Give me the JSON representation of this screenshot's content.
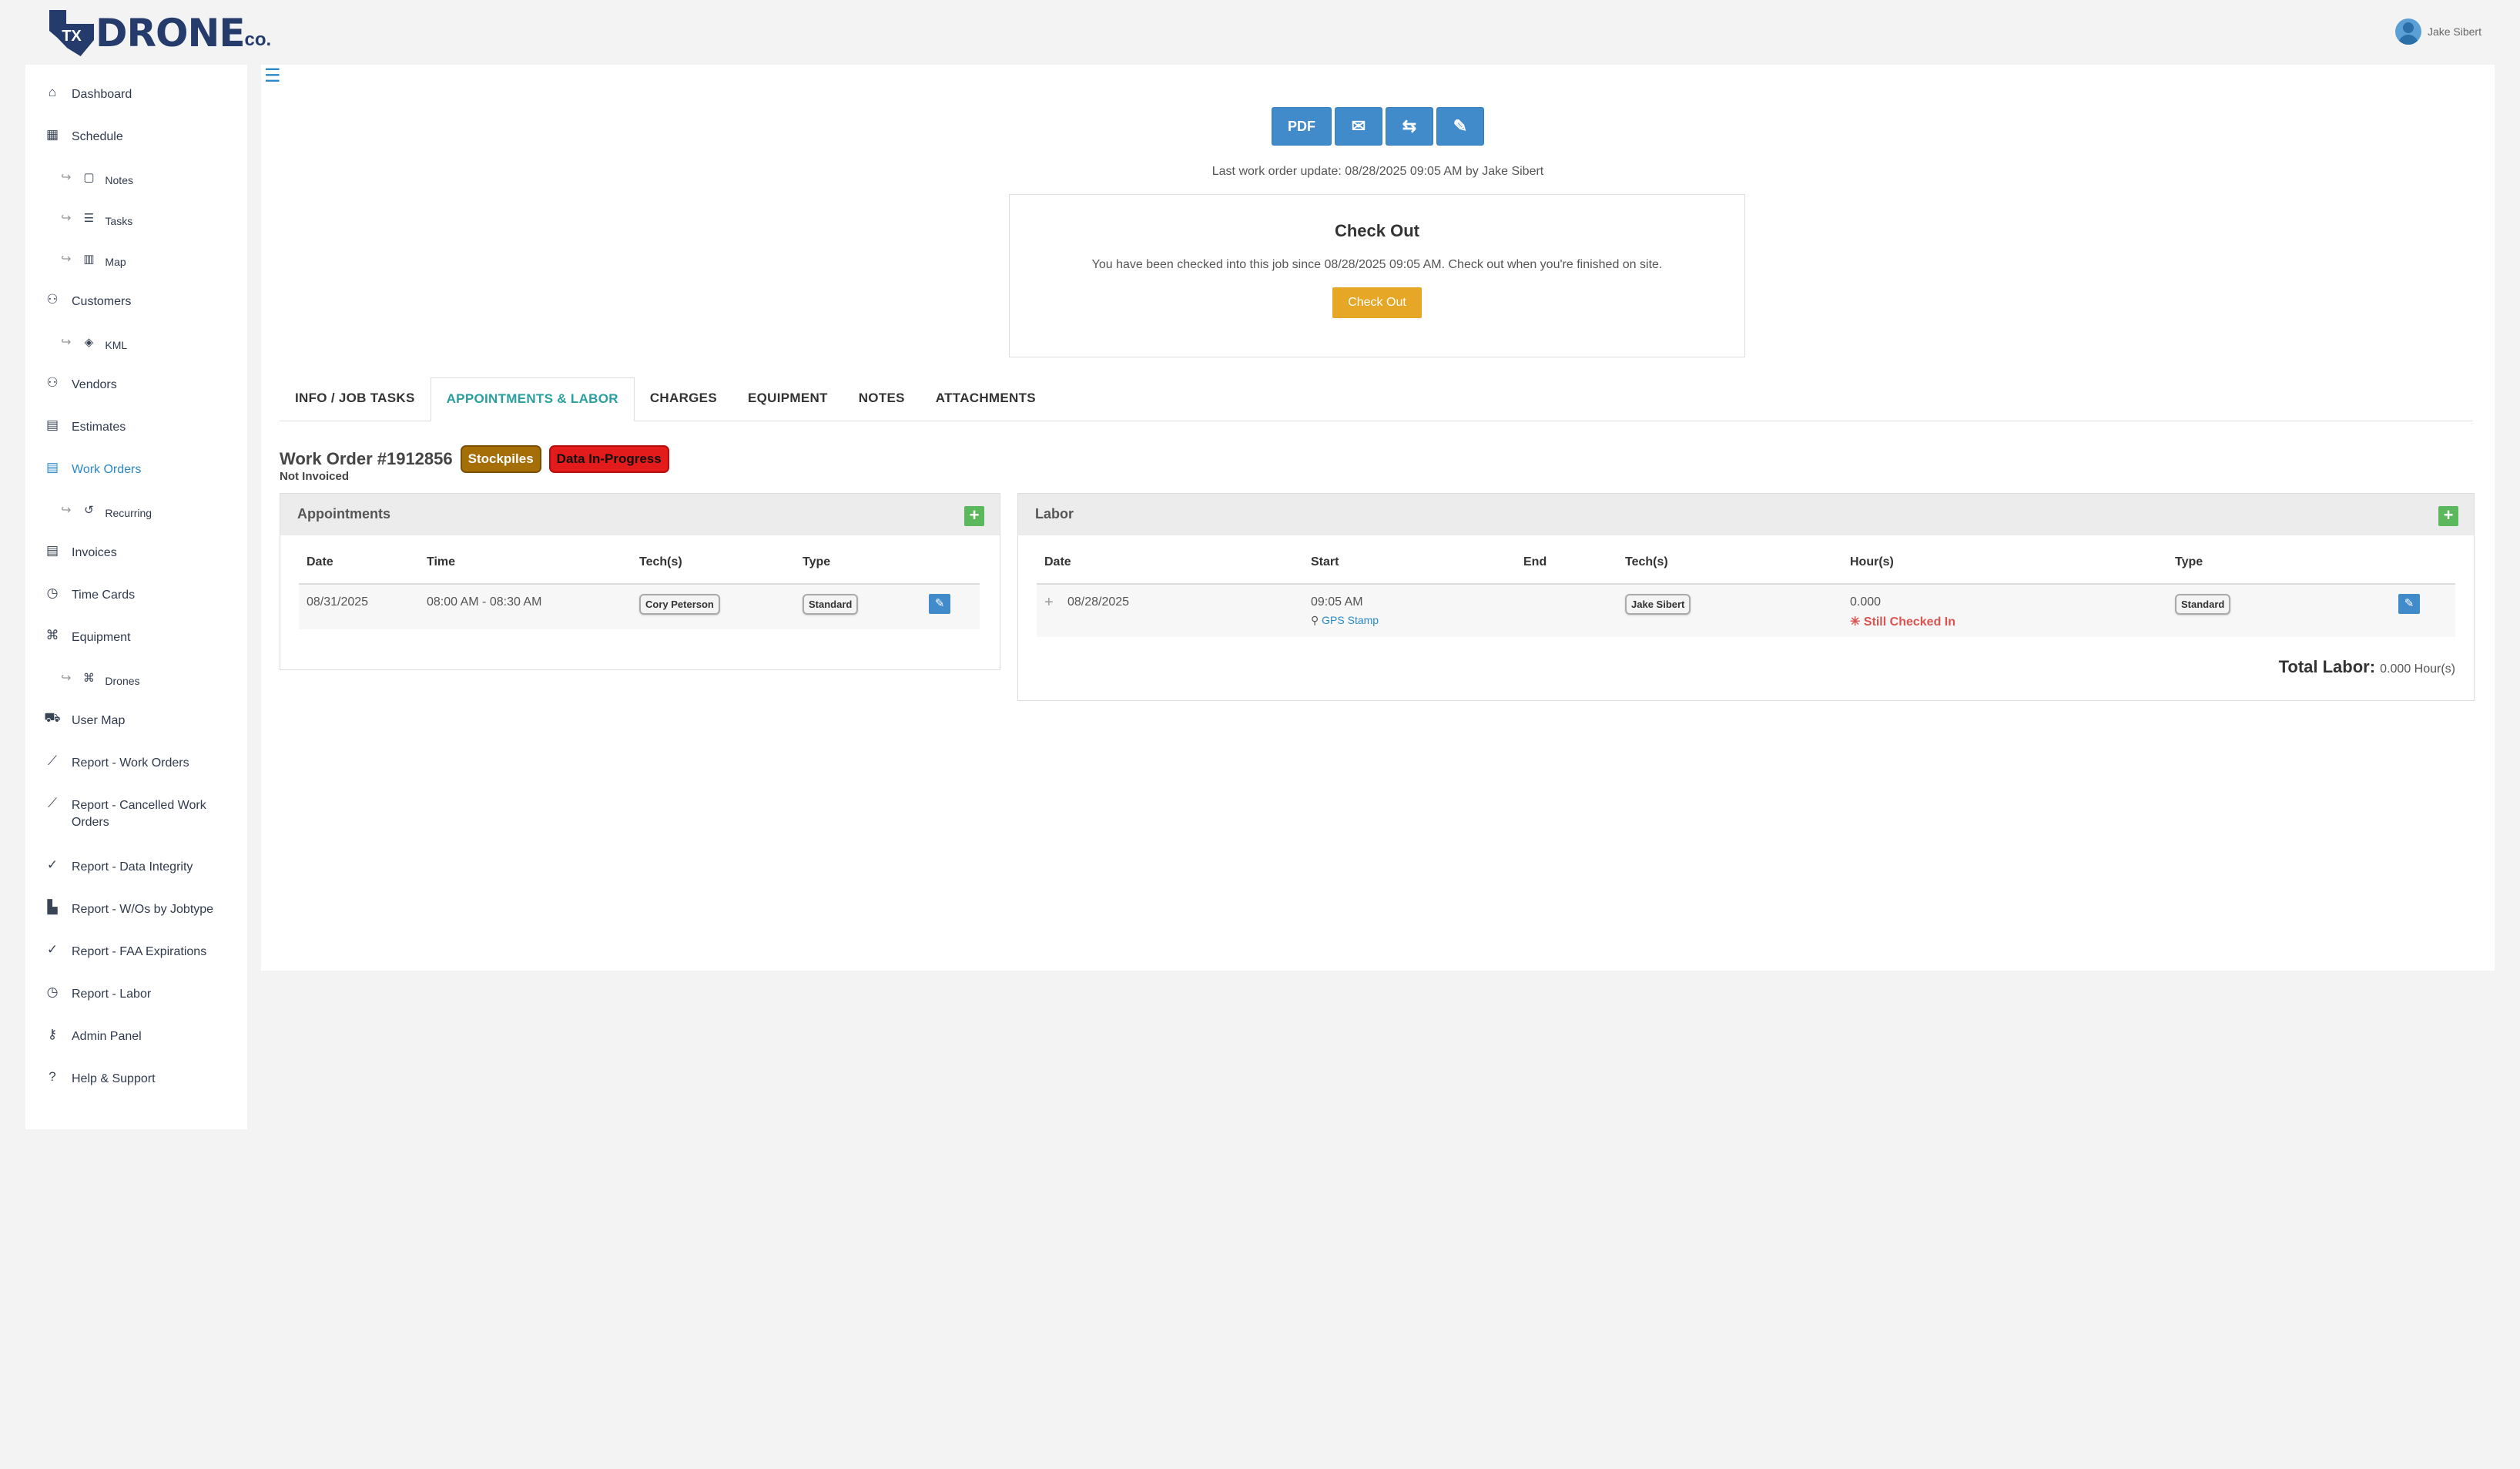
{
  "brand": {
    "tx": "TX",
    "word": "DRONE",
    "co": "co."
  },
  "user": {
    "name": "Jake Sibert"
  },
  "sidebar": {
    "items": [
      {
        "label": "Dashboard",
        "icon": "home-icon",
        "glyph": "⌂"
      },
      {
        "label": "Schedule",
        "icon": "calendar-icon",
        "glyph": "▦"
      },
      {
        "label": "Notes",
        "icon": "note-icon",
        "glyph": "▢",
        "sub": true
      },
      {
        "label": "Tasks",
        "icon": "tasks-icon",
        "glyph": "☰",
        "sub": true
      },
      {
        "label": "Map",
        "icon": "map-icon",
        "glyph": "▥",
        "sub": true
      },
      {
        "label": "Customers",
        "icon": "users-icon",
        "glyph": "⚇"
      },
      {
        "label": "KML",
        "icon": "map-marked-icon",
        "glyph": "◈",
        "sub": true
      },
      {
        "label": "Vendors",
        "icon": "users-cog-icon",
        "glyph": "⚇"
      },
      {
        "label": "Estimates",
        "icon": "file-invoice-icon",
        "glyph": "▤"
      },
      {
        "label": "Work Orders",
        "icon": "file-icon",
        "glyph": "▤",
        "active": true
      },
      {
        "label": "Recurring",
        "icon": "history-icon",
        "glyph": "↺",
        "sub": true
      },
      {
        "label": "Invoices",
        "icon": "file-alt-icon",
        "glyph": "▤"
      },
      {
        "label": "Time Cards",
        "icon": "clock-icon",
        "glyph": "◷"
      },
      {
        "label": "Equipment",
        "icon": "drone-icon",
        "glyph": "⌘"
      },
      {
        "label": "Drones",
        "icon": "drone-icon",
        "glyph": "⌘",
        "sub": true
      },
      {
        "label": "User Map",
        "icon": "truck-icon",
        "glyph": "⛟"
      },
      {
        "label": "Report - Work Orders",
        "icon": "chart-line-icon",
        "glyph": "⟋"
      },
      {
        "label": "Report - Cancelled Work Orders",
        "icon": "chart-line-icon",
        "glyph": "⟋",
        "twoLine": true
      },
      {
        "label": "Report - Data Integrity",
        "icon": "check-icon",
        "glyph": "✓"
      },
      {
        "label": "Report - W/Os by Jobtype",
        "icon": "chart-bar-icon",
        "glyph": "▙"
      },
      {
        "label": "Report - FAA Expirations",
        "icon": "check-icon",
        "glyph": "✓"
      },
      {
        "label": "Report - Labor",
        "icon": "clock-icon",
        "glyph": "◷"
      },
      {
        "label": "Admin Panel",
        "icon": "key-icon",
        "glyph": "⚷"
      },
      {
        "label": "Help & Support",
        "icon": "question-circle-icon",
        "glyph": "?"
      }
    ]
  },
  "toolbar": {
    "pdf_label": "PDF",
    "email_icon": "✉",
    "repeat_icon": "⇆",
    "edit_icon": "✎"
  },
  "last_update": "Last work order update: 08/28/2025 09:05 AM by Jake Sibert",
  "checkout": {
    "title": "Check Out",
    "message": "You have been checked into this job since 08/28/2025 09:05 AM. Check out when you're finished on site.",
    "button": "Check Out"
  },
  "tabs": [
    {
      "label": "INFO / JOB TASKS"
    },
    {
      "label": "APPOINTMENTS & LABOR",
      "active": true
    },
    {
      "label": "CHARGES"
    },
    {
      "label": "EQUIPMENT"
    },
    {
      "label": "NOTES"
    },
    {
      "label": "ATTACHMENTS"
    }
  ],
  "work_order": {
    "title": "Work Order #1912856",
    "badge_type": "Stockpiles",
    "badge_status": "Data In-Progress",
    "invoice_status": "Not Invoiced"
  },
  "appointments": {
    "title": "Appointments",
    "headers": {
      "date": "Date",
      "time": "Time",
      "techs": "Tech(s)",
      "type": "Type"
    },
    "rows": [
      {
        "date": "08/31/2025",
        "time": "08:00 AM - 08:30 AM",
        "tech": "Cory Peterson",
        "type": "Standard"
      }
    ]
  },
  "labor": {
    "title": "Labor",
    "headers": {
      "date": "Date",
      "start": "Start",
      "end": "End",
      "techs": "Tech(s)",
      "hours": "Hour(s)",
      "type": "Type"
    },
    "rows": [
      {
        "date": "08/28/2025",
        "start": "09:05 AM",
        "gps": "GPS Stamp",
        "end": "",
        "tech": "Jake Sibert",
        "hours": "0.000",
        "still": "Still Checked In",
        "type": "Standard"
      }
    ],
    "total_label": "Total Labor:",
    "total_value": "0.000 Hour(s)"
  },
  "colors": {
    "primary": "#428bca",
    "accent_teal": "#29a09d",
    "warning": "#e6a726",
    "success": "#5cb85c",
    "danger": "#d9534f",
    "brand": "#243b6b"
  }
}
